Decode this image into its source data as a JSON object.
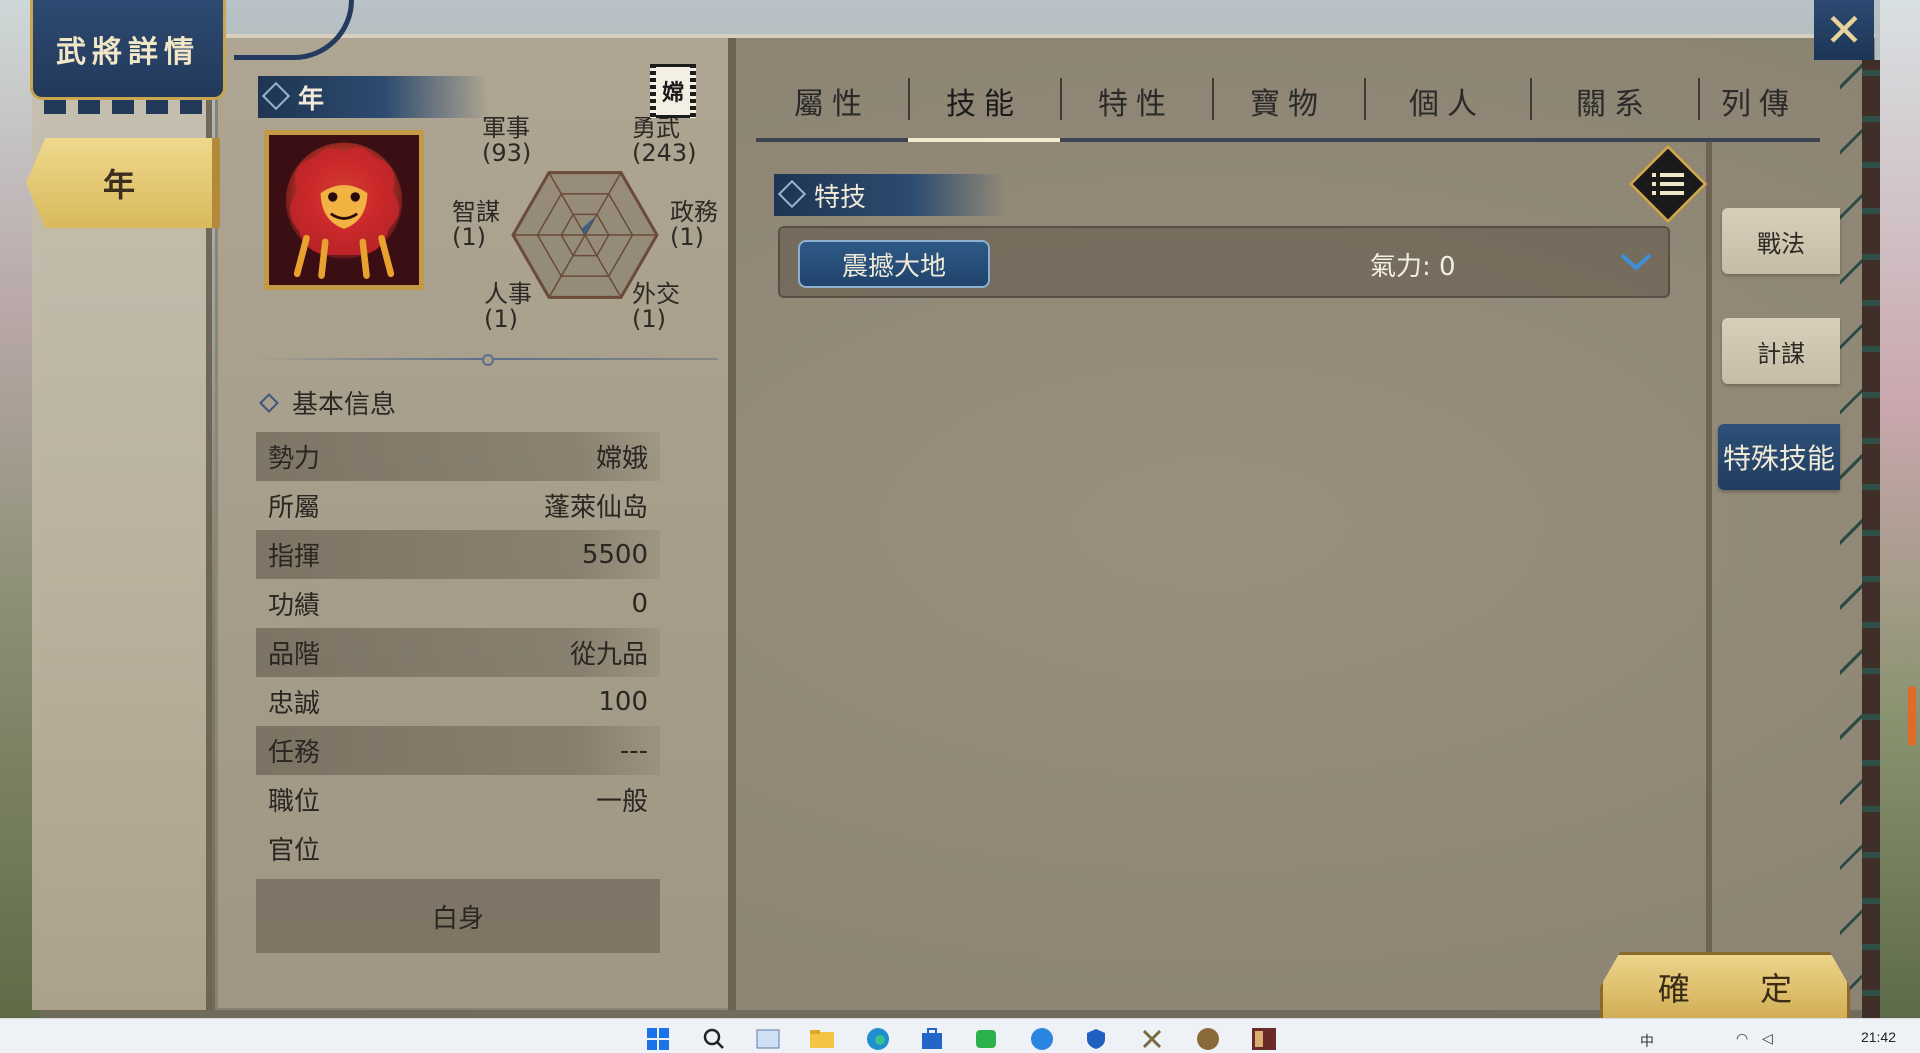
{
  "window": {
    "title": "武將詳情"
  },
  "hero": {
    "name_tab": "年",
    "header_name": "年",
    "faction_flag": "嫦",
    "portrait_icon": "red-lion-beast-portrait"
  },
  "stats": {
    "military": {
      "label": "軍事",
      "value": "(93)"
    },
    "valor": {
      "label": "勇武",
      "value": "(243)"
    },
    "strategy": {
      "label": "智謀",
      "value": "(1)"
    },
    "politics": {
      "label": "政務",
      "value": "(1)"
    },
    "personnel": {
      "label": "人事",
      "value": "(1)"
    },
    "diplomacy": {
      "label": "外交",
      "value": "(1)"
    },
    "chart_levels": {
      "military": 0.1,
      "valor": 0.3,
      "strategy": 0.0,
      "politics": 0.0,
      "personnel": 0.0,
      "diplomacy": 0.0
    },
    "chart_color": "#2f5a86"
  },
  "basic_info": {
    "section_title": "基本信息",
    "rows": [
      {
        "label": "勢力",
        "value": "嫦娥"
      },
      {
        "label": "所屬",
        "value": "蓬萊仙岛"
      },
      {
        "label": "指揮",
        "value": "5500"
      },
      {
        "label": "功績",
        "value": "0"
      },
      {
        "label": "品階",
        "value": "從九品"
      },
      {
        "label": "忠誠",
        "value": "100"
      },
      {
        "label": "任務",
        "value": "---"
      },
      {
        "label": "職位",
        "value": "一般"
      },
      {
        "label": "官位",
        "value": ""
      }
    ],
    "rank_title": "白身"
  },
  "tabs": [
    {
      "label": "屬性",
      "active": false
    },
    {
      "label": "技能",
      "active": true
    },
    {
      "label": "特性",
      "active": false
    },
    {
      "label": "寶物",
      "active": false
    },
    {
      "label": "個人",
      "active": false
    },
    {
      "label": "關系",
      "active": false
    },
    {
      "label": "列傳",
      "active": false
    }
  ],
  "skills": {
    "section_title": "特技",
    "items": [
      {
        "name": "震撼大地",
        "energy": "氣力: 0"
      }
    ]
  },
  "side_tabs": [
    {
      "label": "戰法",
      "active": false
    },
    {
      "label": "計謀",
      "active": false
    },
    {
      "label": "特殊技能",
      "active": true
    }
  ],
  "buttons": {
    "close_symbol": "✕",
    "confirm": "確 定"
  },
  "taskbar": {
    "clock": "21:42",
    "tray_text": "中"
  },
  "colors": {
    "accent_blue": "#2d4b70",
    "gold": "#d9b95c",
    "panel": "#a39a88"
  }
}
